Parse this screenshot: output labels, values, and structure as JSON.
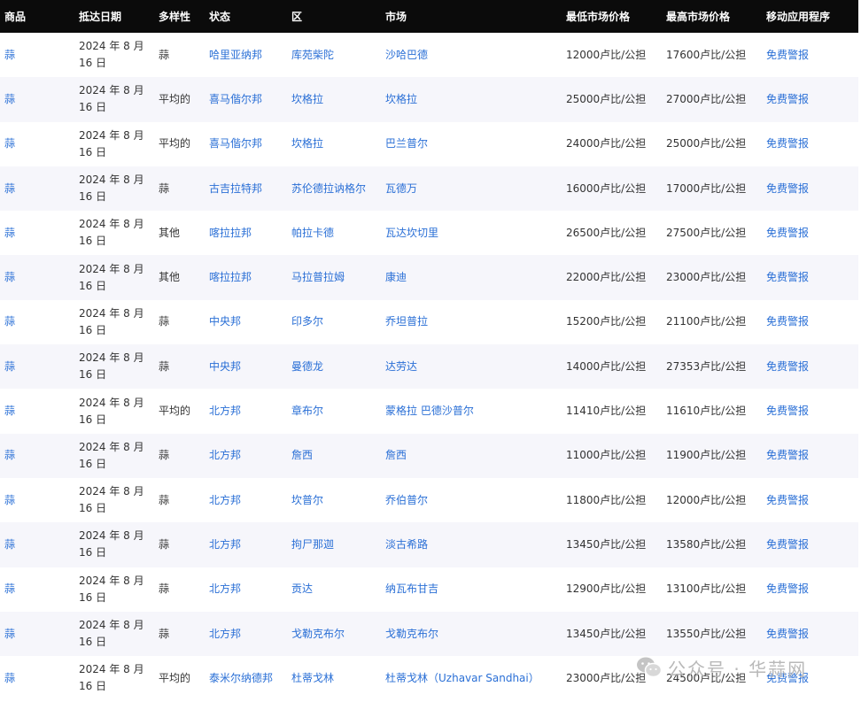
{
  "table": {
    "headers": [
      "商品",
      "抵达日期",
      "多样性",
      "状态",
      "区",
      "市场",
      "最低市场价格",
      "最高市场价格",
      "移动应用程序"
    ],
    "rows": [
      [
        "蒜",
        "2024 年 8 月 16 日",
        "蒜",
        "哈里亚纳邦",
        "库苑柴陀",
        "沙哈巴德",
        "12000卢比/公担",
        "17600卢比/公担",
        "免费警报"
      ],
      [
        "蒜",
        "2024 年 8 月 16 日",
        "平均的",
        "喜马偕尔邦",
        "坎格拉",
        "坎格拉",
        "25000卢比/公担",
        "27000卢比/公担",
        "免费警报"
      ],
      [
        "蒜",
        "2024 年 8 月 16 日",
        "平均的",
        "喜马偕尔邦",
        "坎格拉",
        "巴兰普尔",
        "24000卢比/公担",
        "25000卢比/公担",
        "免费警报"
      ],
      [
        "蒜",
        "2024 年 8 月 16 日",
        "蒜",
        "古吉拉特邦",
        "苏伦德拉讷格尔",
        "瓦德万",
        "16000卢比/公担",
        "17000卢比/公担",
        "免费警报"
      ],
      [
        "蒜",
        "2024 年 8 月 16 日",
        "其他",
        "喀拉拉邦",
        "帕拉卡德",
        "瓦达坎切里",
        "26500卢比/公担",
        "27500卢比/公担",
        "免费警报"
      ],
      [
        "蒜",
        "2024 年 8 月 16 日",
        "其他",
        "喀拉拉邦",
        "马拉普拉姆",
        "康迪",
        "22000卢比/公担",
        "23000卢比/公担",
        "免费警报"
      ],
      [
        "蒜",
        "2024 年 8 月 16 日",
        "蒜",
        "中央邦",
        "印多尔",
        "乔坦普拉",
        "15200卢比/公担",
        "21100卢比/公担",
        "免费警报"
      ],
      [
        "蒜",
        "2024 年 8 月 16 日",
        "蒜",
        "中央邦",
        "曼德龙",
        "达劳达",
        "14000卢比/公担",
        "27353卢比/公担",
        "免费警报"
      ],
      [
        "蒜",
        "2024 年 8 月 16 日",
        "平均的",
        "北方邦",
        "章布尔",
        "蒙格拉 巴德沙普尔",
        "11410卢比/公担",
        "11610卢比/公担",
        "免费警报"
      ],
      [
        "蒜",
        "2024 年 8 月 16 日",
        "蒜",
        "北方邦",
        "詹西",
        "詹西",
        "11000卢比/公担",
        "11900卢比/公担",
        "免费警报"
      ],
      [
        "蒜",
        "2024 年 8 月 16 日",
        "蒜",
        "北方邦",
        "坎普尔",
        "乔伯普尔",
        "11800卢比/公担",
        "12000卢比/公担",
        "免费警报"
      ],
      [
        "蒜",
        "2024 年 8 月 16 日",
        "蒜",
        "北方邦",
        "拘尸那迦",
        "淡古希路",
        "13450卢比/公担",
        "13580卢比/公担",
        "免费警报"
      ],
      [
        "蒜",
        "2024 年 8 月 16 日",
        "蒜",
        "北方邦",
        "贡达",
        "纳瓦布甘吉",
        "12900卢比/公担",
        "13100卢比/公担",
        "免费警报"
      ],
      [
        "蒜",
        "2024 年 8 月 16 日",
        "蒜",
        "北方邦",
        "戈勒克布尔",
        "戈勒克布尔",
        "13450卢比/公担",
        "13550卢比/公担",
        "免费警报"
      ],
      [
        "蒜",
        "2024 年 8 月 16 日",
        "平均的",
        "泰米尔纳德邦",
        "杜蒂戈林",
        "杜蒂戈林（Uzhavar Sandhai）",
        "23000卢比/公担",
        "24500卢比/公担",
        "免费警报"
      ]
    ]
  },
  "watermark": {
    "text": "公众号 · 华蒜网",
    "icon": "wechat-icon"
  },
  "colors": {
    "header_bg": "#0b0b0b",
    "link": "#2a6fd6",
    "row_alt": "#f6f6fb"
  }
}
